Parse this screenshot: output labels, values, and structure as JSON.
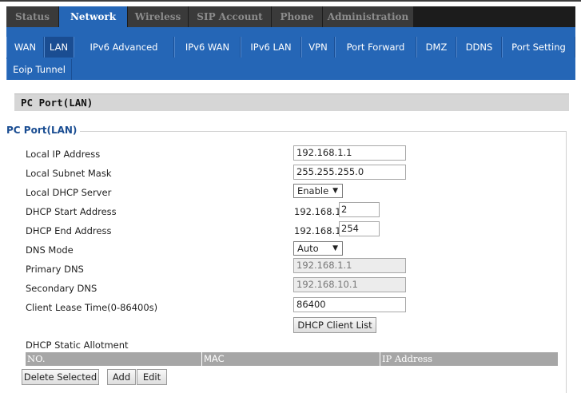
{
  "main_tabs": [
    {
      "label": "Status",
      "active": false
    },
    {
      "label": "Network",
      "active": true
    },
    {
      "label": "Wireless",
      "active": false
    },
    {
      "label": "SIP Account",
      "active": false
    },
    {
      "label": "Phone",
      "active": false
    },
    {
      "label": "Administration",
      "active": false
    }
  ],
  "sub_tabs": [
    {
      "label": "WAN",
      "active": false
    },
    {
      "label": "LAN",
      "active": true
    },
    {
      "label": "IPv6 Advanced",
      "active": false
    },
    {
      "label": "IPv6 WAN",
      "active": false
    },
    {
      "label": "IPv6 LAN",
      "active": false
    },
    {
      "label": "VPN",
      "active": false
    },
    {
      "label": "Port Forward",
      "active": false
    },
    {
      "label": "DMZ",
      "active": false
    },
    {
      "label": "DDNS",
      "active": false
    },
    {
      "label": "Port Setting",
      "active": false
    },
    {
      "label": "Eoip Tunnel",
      "active": false
    }
  ],
  "panel": {
    "header": "PC Port(LAN)",
    "legend": "PC Port(LAN)"
  },
  "form": {
    "local_ip": {
      "label": "Local IP Address",
      "value": "192.168.1.1"
    },
    "subnet": {
      "label": "Local Subnet Mask",
      "value": "255.255.255.0"
    },
    "dhcp_server": {
      "label": "Local DHCP Server",
      "value": "Enable"
    },
    "dhcp_start": {
      "label": "DHCP Start Address",
      "prefix": "192.168.1.",
      "value": "2"
    },
    "dhcp_end": {
      "label": "DHCP End Address",
      "prefix": "192.168.1.",
      "value": "254"
    },
    "dns_mode": {
      "label": "DNS Mode",
      "value": "Auto"
    },
    "primary_dns": {
      "label": "Primary DNS",
      "value": "192.168.1.1"
    },
    "secondary_dns": {
      "label": "Secondary DNS",
      "value": "192.168.10.1"
    },
    "lease_time": {
      "label": "Client Lease Time(0-86400s)",
      "value": "86400"
    },
    "client_list_button": "DHCP Client List"
  },
  "static": {
    "label": "DHCP Static Allotment",
    "columns": [
      "NO.",
      "MAC",
      "IP Address"
    ],
    "buttons": {
      "delete": "Delete Selected",
      "add": "Add",
      "edit": "Edit"
    }
  },
  "colors": {
    "accent": "#2566b6",
    "nav_bg": "#1c1c1c",
    "legend": "#1a4d92"
  }
}
